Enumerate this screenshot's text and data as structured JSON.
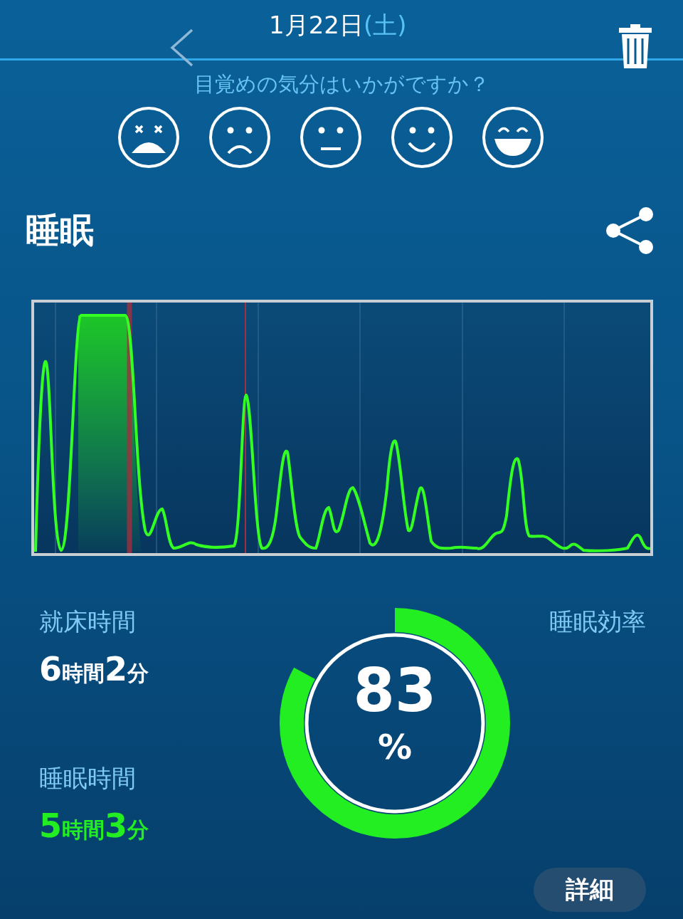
{
  "header": {
    "date": "1月22日",
    "weekday": "(土)"
  },
  "mood": {
    "question": "目覚めの気分はいかがですか？",
    "faces": [
      {
        "kind": "dizzy"
      },
      {
        "kind": "sad"
      },
      {
        "kind": "neutral"
      },
      {
        "kind": "smile"
      },
      {
        "kind": "grin"
      }
    ]
  },
  "section": {
    "title": "睡眠"
  },
  "stats": [
    {
      "label": "就床時間",
      "value": "6時間2分",
      "kind": "normal"
    },
    {
      "label": "睡眠時間",
      "value": "5時間3分",
      "kind": "highlight"
    }
  ],
  "efficiency": {
    "label": "睡眠効率",
    "value": "83",
    "unit": "%",
    "level": 0.83
  },
  "details_button": "詳細"
}
